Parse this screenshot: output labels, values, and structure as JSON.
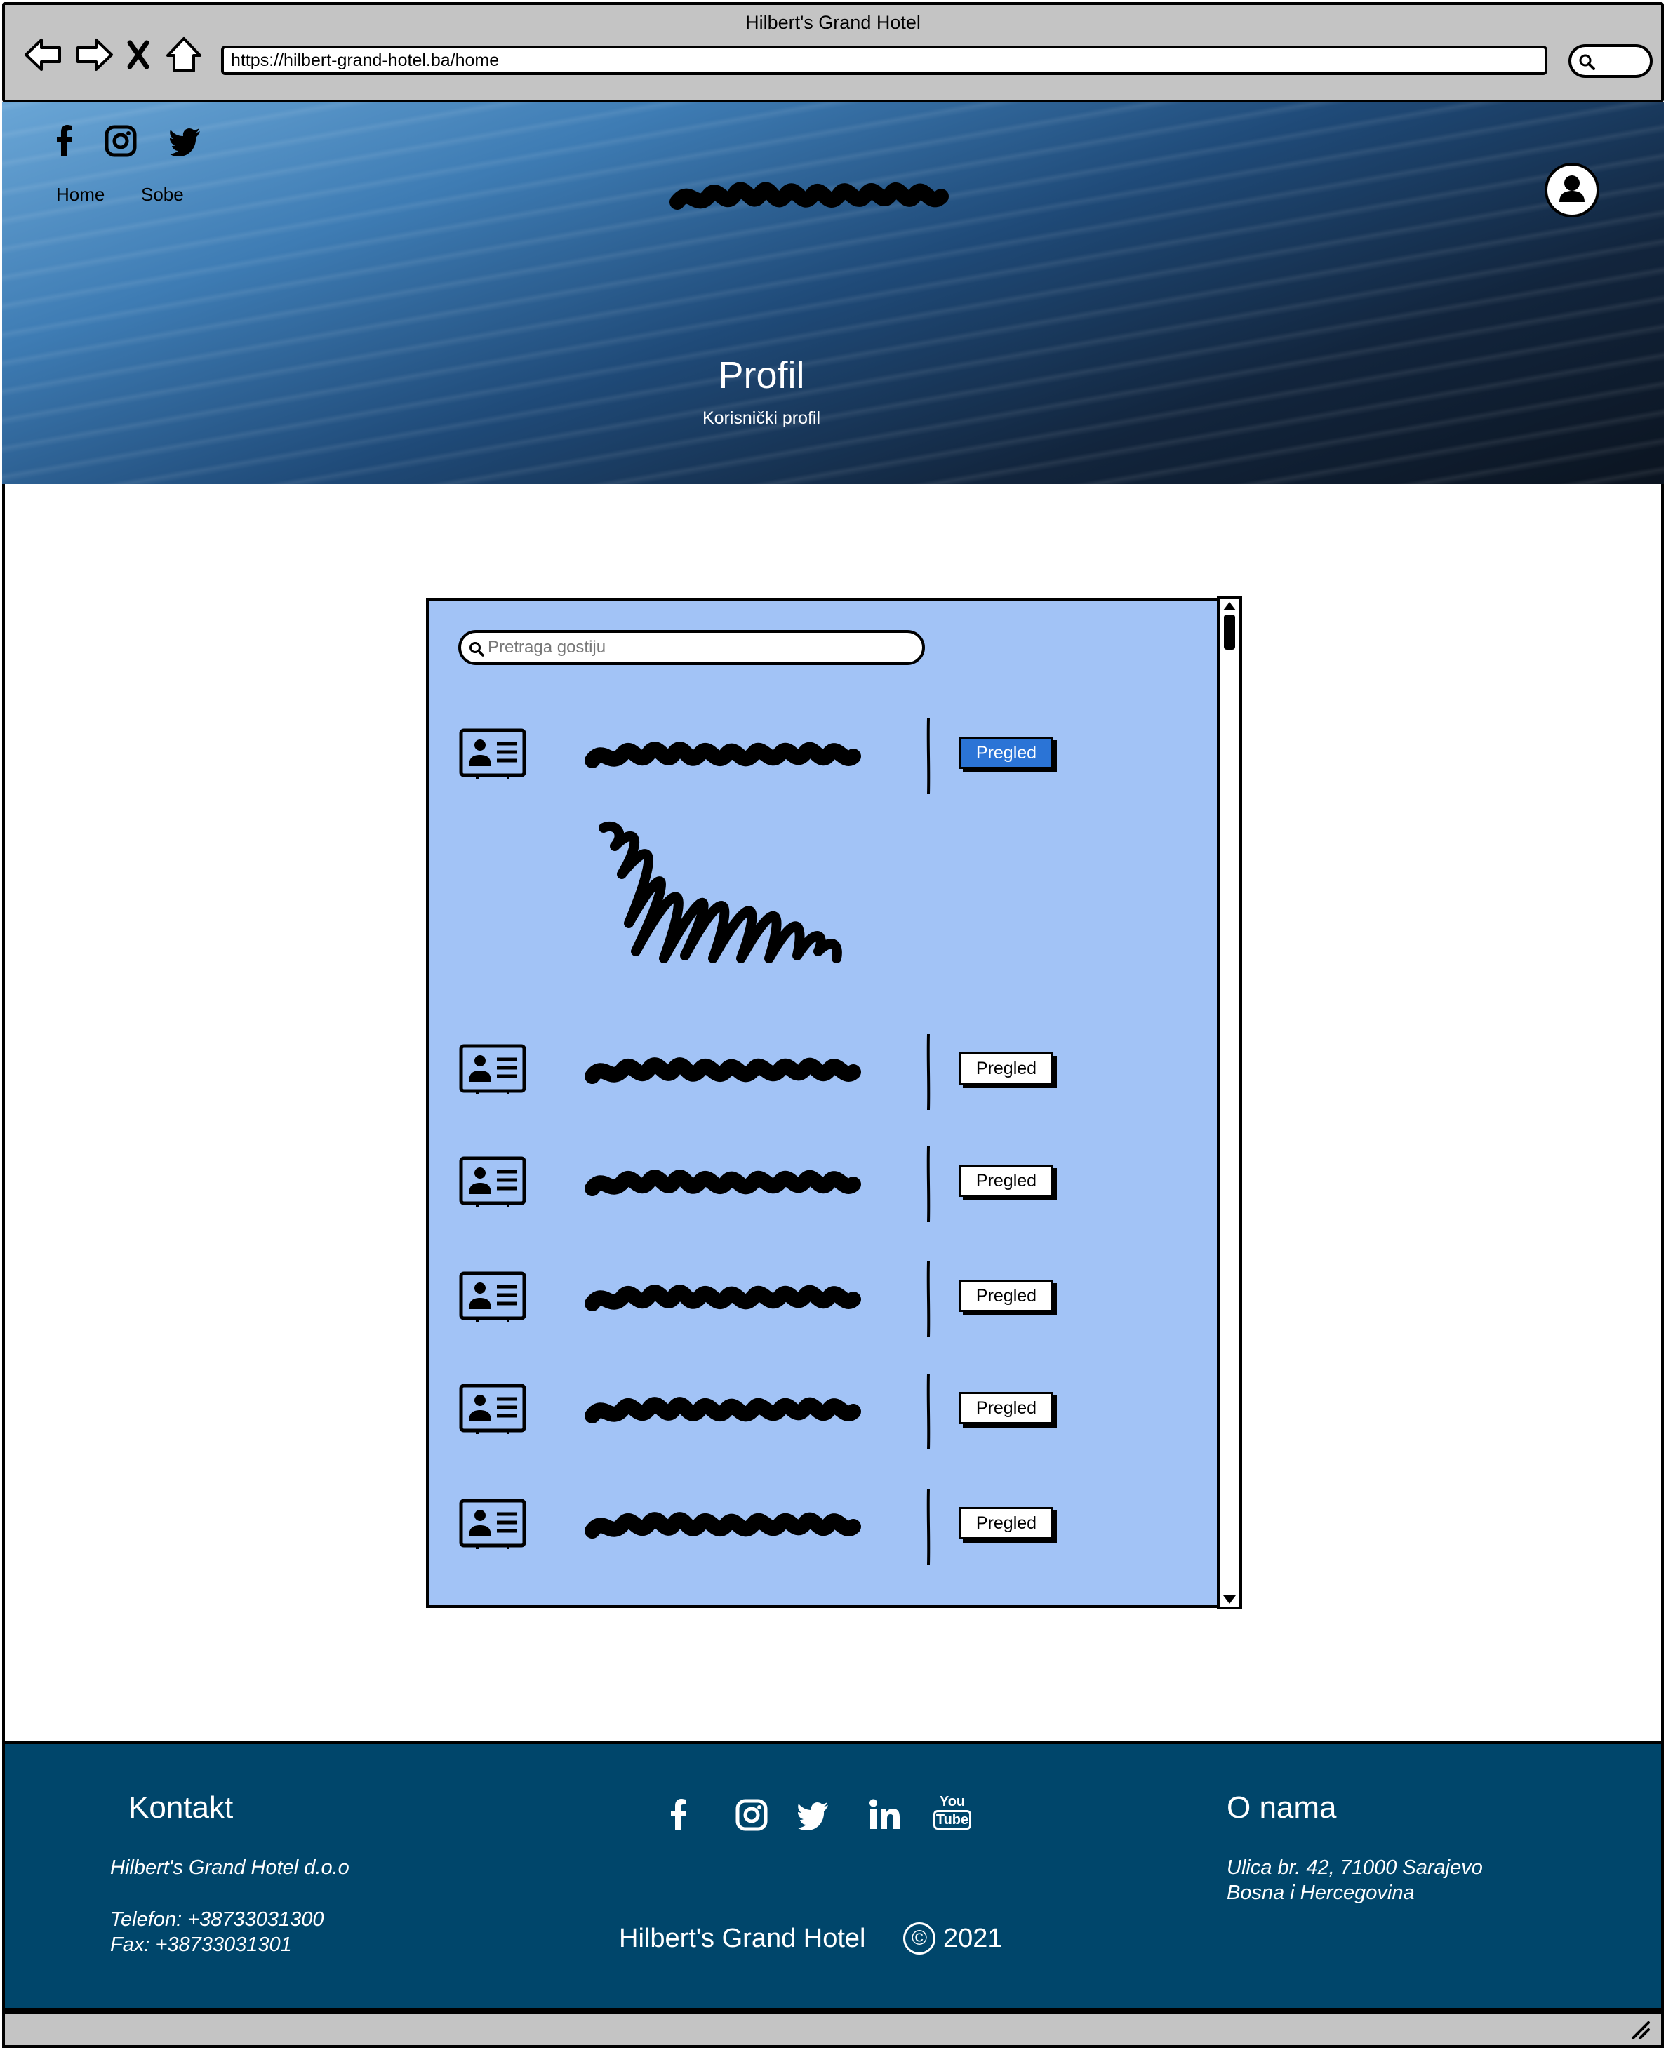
{
  "browser": {
    "window_title": "Hilbert's Grand Hotel",
    "url": "https://hilbert-grand-hotel.ba/home"
  },
  "header": {
    "social_icons": [
      "facebook-icon",
      "instagram-icon",
      "twitter-icon"
    ],
    "nav": {
      "home": "Home",
      "rooms": "Sobe"
    },
    "title": "Profil",
    "subtitle": "Korisnički profil"
  },
  "guest_panel": {
    "search_placeholder": "Pretraga gostiju",
    "view_button_label": "Pregled",
    "rows": [
      {
        "button": "Pregled",
        "selected": true
      },
      {
        "button": "Pregled",
        "selected": false
      },
      {
        "button": "Pregled",
        "selected": false
      },
      {
        "button": "Pregled",
        "selected": false
      },
      {
        "button": "Pregled",
        "selected": false
      },
      {
        "button": "Pregled",
        "selected": false
      }
    ]
  },
  "footer": {
    "contact_title": "Kontakt",
    "company": "Hilbert's Grand Hotel d.o.o",
    "phone": "Telefon: +38733031300",
    "fax": "Fax: +38733031301",
    "social_icons": [
      "facebook-icon",
      "instagram-icon",
      "twitter-icon",
      "linkedin-icon",
      "youtube-icon"
    ],
    "youtube_text": {
      "you": "You",
      "tube": "Tube"
    },
    "brand": "Hilbert's Grand Hotel",
    "copyright_symbol": "©",
    "year": "2021",
    "about_title": "O nama",
    "address_line1": "Ulica br. 42, 71000 Sarajevo",
    "address_line2": "Bosna i Hercegovina"
  },
  "colors": {
    "panel": "#a2c3f6",
    "selected_button": "#2b74d6",
    "footer": "#00466b",
    "chrome": "#c4c4c4"
  }
}
